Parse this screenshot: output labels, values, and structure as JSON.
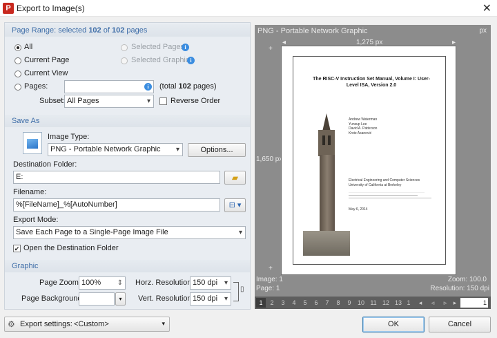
{
  "window": {
    "title": "Export to Image(s)",
    "app_icon": "pdf-xchange-icon"
  },
  "page_range": {
    "header_prefix": "Page Range: selected ",
    "selected": "102",
    "header_mid": " of ",
    "total": "102",
    "header_suffix": " pages",
    "options": [
      "All",
      "Current Page",
      "Current View",
      "Pages:"
    ],
    "disabled_options": [
      "Selected Pages",
      "Selected Graphic"
    ],
    "pages_input": "",
    "pages_total_prefix": "(total ",
    "pages_total_count": "102",
    "pages_total_suffix": " pages)",
    "subset_label": "Subset:",
    "subset_value": "All Pages",
    "reverse_order_label": "Reverse Order"
  },
  "save_as": {
    "header": "Save As",
    "image_type_label": "Image Type:",
    "image_type_value": "PNG - Portable Network Graphic",
    "options_button": "Options...",
    "destination_label": "Destination Folder:",
    "destination_value": "E:",
    "filename_label": "Filename:",
    "filename_value": "%[FileName]_%[AutoNumber]",
    "export_mode_label": "Export Mode:",
    "export_mode_value": "Save Each Page to a Single-Page Image File",
    "open_folder_label": "Open the Destination Folder",
    "open_folder_checked": true
  },
  "graphic": {
    "header": "Graphic",
    "page_zoom_label": "Page Zoom:",
    "page_zoom_value": "100%",
    "horz_res_label": "Horz. Resolution:",
    "horz_res_value": "150 dpi",
    "page_bg_label": "Page Background:",
    "vert_res_label": "Vert. Resolution:",
    "vert_res_value": "150 dpi"
  },
  "preview": {
    "format_label": "PNG - Portable Network Graphic",
    "unit": "px",
    "width_label": "1,275 px",
    "height_label": "1,650 px",
    "image_info": "Image: 1",
    "page_info": "Page: 1",
    "zoom_info": "Zoom: 100.0",
    "resolution_info": "Resolution: 150 dpi",
    "doc_title": "The RISC-V Instruction Set Manual, Volume I: User-Level ISA, Version 2.0",
    "doc_authors": "Andrew Waterman\nYunsup Lee\nDavid A. Patterson\nKrste Asanović",
    "doc_dept": "Electrical Engineering and Computer Sciences\nUniversity of California at Berkeley",
    "doc_date": "May 6, 2014",
    "pages": [
      "1",
      "2",
      "3",
      "4",
      "5",
      "6",
      "7",
      "8",
      "9",
      "10",
      "11",
      "12",
      "13",
      "1"
    ],
    "page_input": "1"
  },
  "footer": {
    "export_settings_label": "Export settings:",
    "export_settings_value": "<Custom>",
    "ok_button": "OK",
    "cancel_button": "Cancel"
  },
  "colors": {
    "section_header_text": "#3f6ea8",
    "preview_bg": "#8c8c8c",
    "brand": "#c8281e"
  }
}
